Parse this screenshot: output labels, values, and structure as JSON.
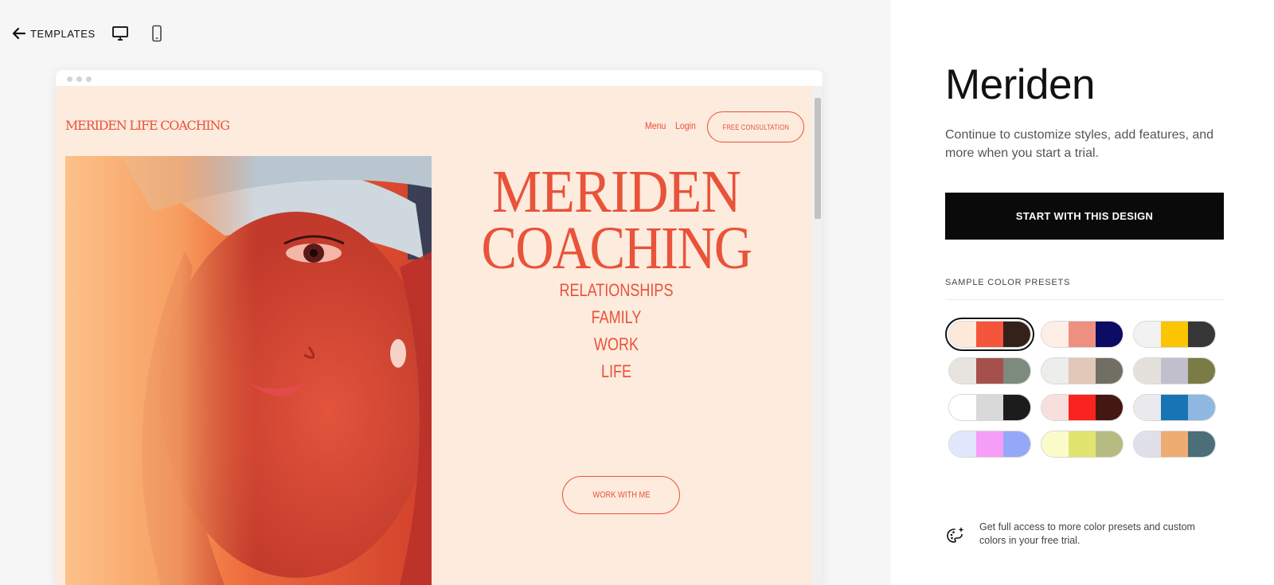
{
  "toolbar": {
    "back_label": "TEMPLATES",
    "back_icon": "arrow-left-icon",
    "desktop_icon": "desktop-icon",
    "mobile_icon": "mobile-icon"
  },
  "preview": {
    "site_logo": "MERIDEN LIFE COACHING",
    "nav": {
      "menu": "Menu",
      "login": "Login",
      "cta": "FREE CONSULTATION"
    },
    "hero": {
      "title_line1": "MERIDEN",
      "title_line2": "COACHING",
      "subtitle_lines": [
        "RELATIONSHIPS",
        "FAMILY",
        "WORK",
        "LIFE"
      ],
      "button": "WORK WITH ME"
    },
    "colors": {
      "background": "#fdebdd",
      "accent": "#e8533a"
    }
  },
  "panel": {
    "title": "Meriden",
    "description": "Continue to customize styles, add features, and more when you start a trial.",
    "start_button": "START WITH THIS DESIGN",
    "presets_heading": "SAMPLE COLOR PRESETS",
    "presets": [
      {
        "colors": [
          "#fde9da",
          "#f5553a",
          "#34211b"
        ],
        "selected": true
      },
      {
        "colors": [
          "#fdeee6",
          "#ef8f80",
          "#0c0c64"
        ],
        "selected": false
      },
      {
        "colors": [
          "#f2f2f2",
          "#fbc502",
          "#373737"
        ],
        "selected": false
      },
      {
        "colors": [
          "#e7e3df",
          "#a5504c",
          "#7d8b7c"
        ],
        "selected": false
      },
      {
        "colors": [
          "#ededeb",
          "#e1c8b9",
          "#716f63"
        ],
        "selected": false
      },
      {
        "colors": [
          "#e4e1dc",
          "#c2bfcd",
          "#7b7c45"
        ],
        "selected": false
      },
      {
        "colors": [
          "#ffffff",
          "#d9d9d9",
          "#1c1c1c"
        ],
        "selected": false
      },
      {
        "colors": [
          "#f8dfdd",
          "#fa2320",
          "#441712"
        ],
        "selected": false
      },
      {
        "colors": [
          "#e9e9ee",
          "#1874b4",
          "#8fb7e2"
        ],
        "selected": false
      },
      {
        "colors": [
          "#e2e6fd",
          "#f69df7",
          "#93a9f7"
        ],
        "selected": false
      },
      {
        "colors": [
          "#fbfbc9",
          "#e2e470",
          "#b6bb82"
        ],
        "selected": false
      },
      {
        "colors": [
          "#e0e0ea",
          "#eeac72",
          "#4b6e79"
        ],
        "selected": false
      }
    ],
    "upsell_text": "Get full access to more color presets and custom colors in your free trial.",
    "upsell_icon": "palette-sparkle-icon"
  }
}
